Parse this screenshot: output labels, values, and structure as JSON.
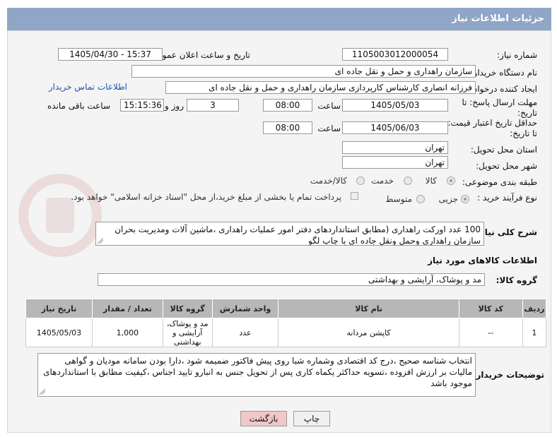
{
  "header": {
    "title": "جزئیات اطلاعات نیاز"
  },
  "fields": {
    "need_number_label": "شماره نیاز:",
    "need_number": "1105003012000054",
    "announce_label": "تاریخ و ساعت اعلان عمومی:",
    "announce_value": "1405/04/30 - 15:37",
    "buyer_org_label": "نام دستگاه خریدار:",
    "buyer_org": "سازمان راهداری و حمل و نقل جاده ای",
    "creator_label": "ایجاد کننده درخواست:",
    "creator": "فرزانه انصاری کارشناس کارپردازی سازمان راهداری و حمل و نقل جاده ای",
    "buyer_contact_link": "اطلاعات تماس خریدار",
    "deadline_label": "مهلت ارسال پاسخ: تا تاریخ:",
    "deadline_date": "1405/05/03",
    "time_label": "ساعت",
    "deadline_time": "08:00",
    "days_value": "3",
    "days_label": "روز و",
    "remaining_time": "15:15:36",
    "remaining_label": "ساعت باقی مانده",
    "price_validity_label": "حداقل تاریخ اعتبار قیمت: تا تاریخ:",
    "price_validity_date": "1405/06/03",
    "price_validity_time": "08:00",
    "province_label": "استان محل تحویل:",
    "province": "تهران",
    "city_label": "شهر محل تحویل:",
    "city": "تهران",
    "category_label": "طبقه بندی موضوعی:",
    "category_options": [
      "کالا",
      "خدمت",
      "کالا/خدمت"
    ],
    "process_label": "نوع فرآیند خرید :",
    "process_options": [
      "جزیی",
      "متوسط"
    ],
    "payment_note": "پرداخت تمام یا بخشی از مبلغ خرید،از محل \"اسناد خزانه اسلامی\" خواهد بود."
  },
  "description": {
    "label": "شرح کلی نیاز:",
    "text": "100 عدد اورکت راهداری (مطابق استانداردهای دفتر امور عملیات راهداری ،ماشین آلات ومدیریت بحران سازمان راهداری وحمل ونقل جاده ای با چاپ لگو"
  },
  "goods": {
    "section_title": "اطلاعات کالاهای مورد نیاز",
    "group_label": "گروه کالا:",
    "group_value": "مد و پوشاک، آرایشی و بهداشتی",
    "columns": [
      "ردیف",
      "کد کالا",
      "نام کالا",
      "واحد شمارش",
      "گروه کالا",
      "تعداد / مقدار",
      "تاریخ نیاز"
    ],
    "rows": [
      {
        "row": "1",
        "code": "--",
        "name": "کاپشن مردانه",
        "unit": "عدد",
        "group": "مد و پوشاک، آرایشی و بهداشتی",
        "qty": "1,000",
        "date": "1405/05/03"
      }
    ]
  },
  "buyer_notes": {
    "label": "توضیحات خریدار:",
    "text": "انتخاب شناسه صحیح ،درج کد اقتصادی وشماره شبا روی پیش فاکتور ضمیمه شود ،دارا بودن سامانه مودیان و گواهی مالیات بر ارزش افزوده ،تسویه حداکثر یکماه کاری پس از تحویل جنس به انبارو تایید اجناس ،کیفیت مطابق با استانداردهای موجود باشد"
  },
  "buttons": {
    "print": "چاپ",
    "back": "بازگشت"
  },
  "colors": {
    "header": "#8fa6c6",
    "table_header": "#b7b7b7",
    "link": "#1a55b3",
    "back_button": "#f2c7c7"
  }
}
